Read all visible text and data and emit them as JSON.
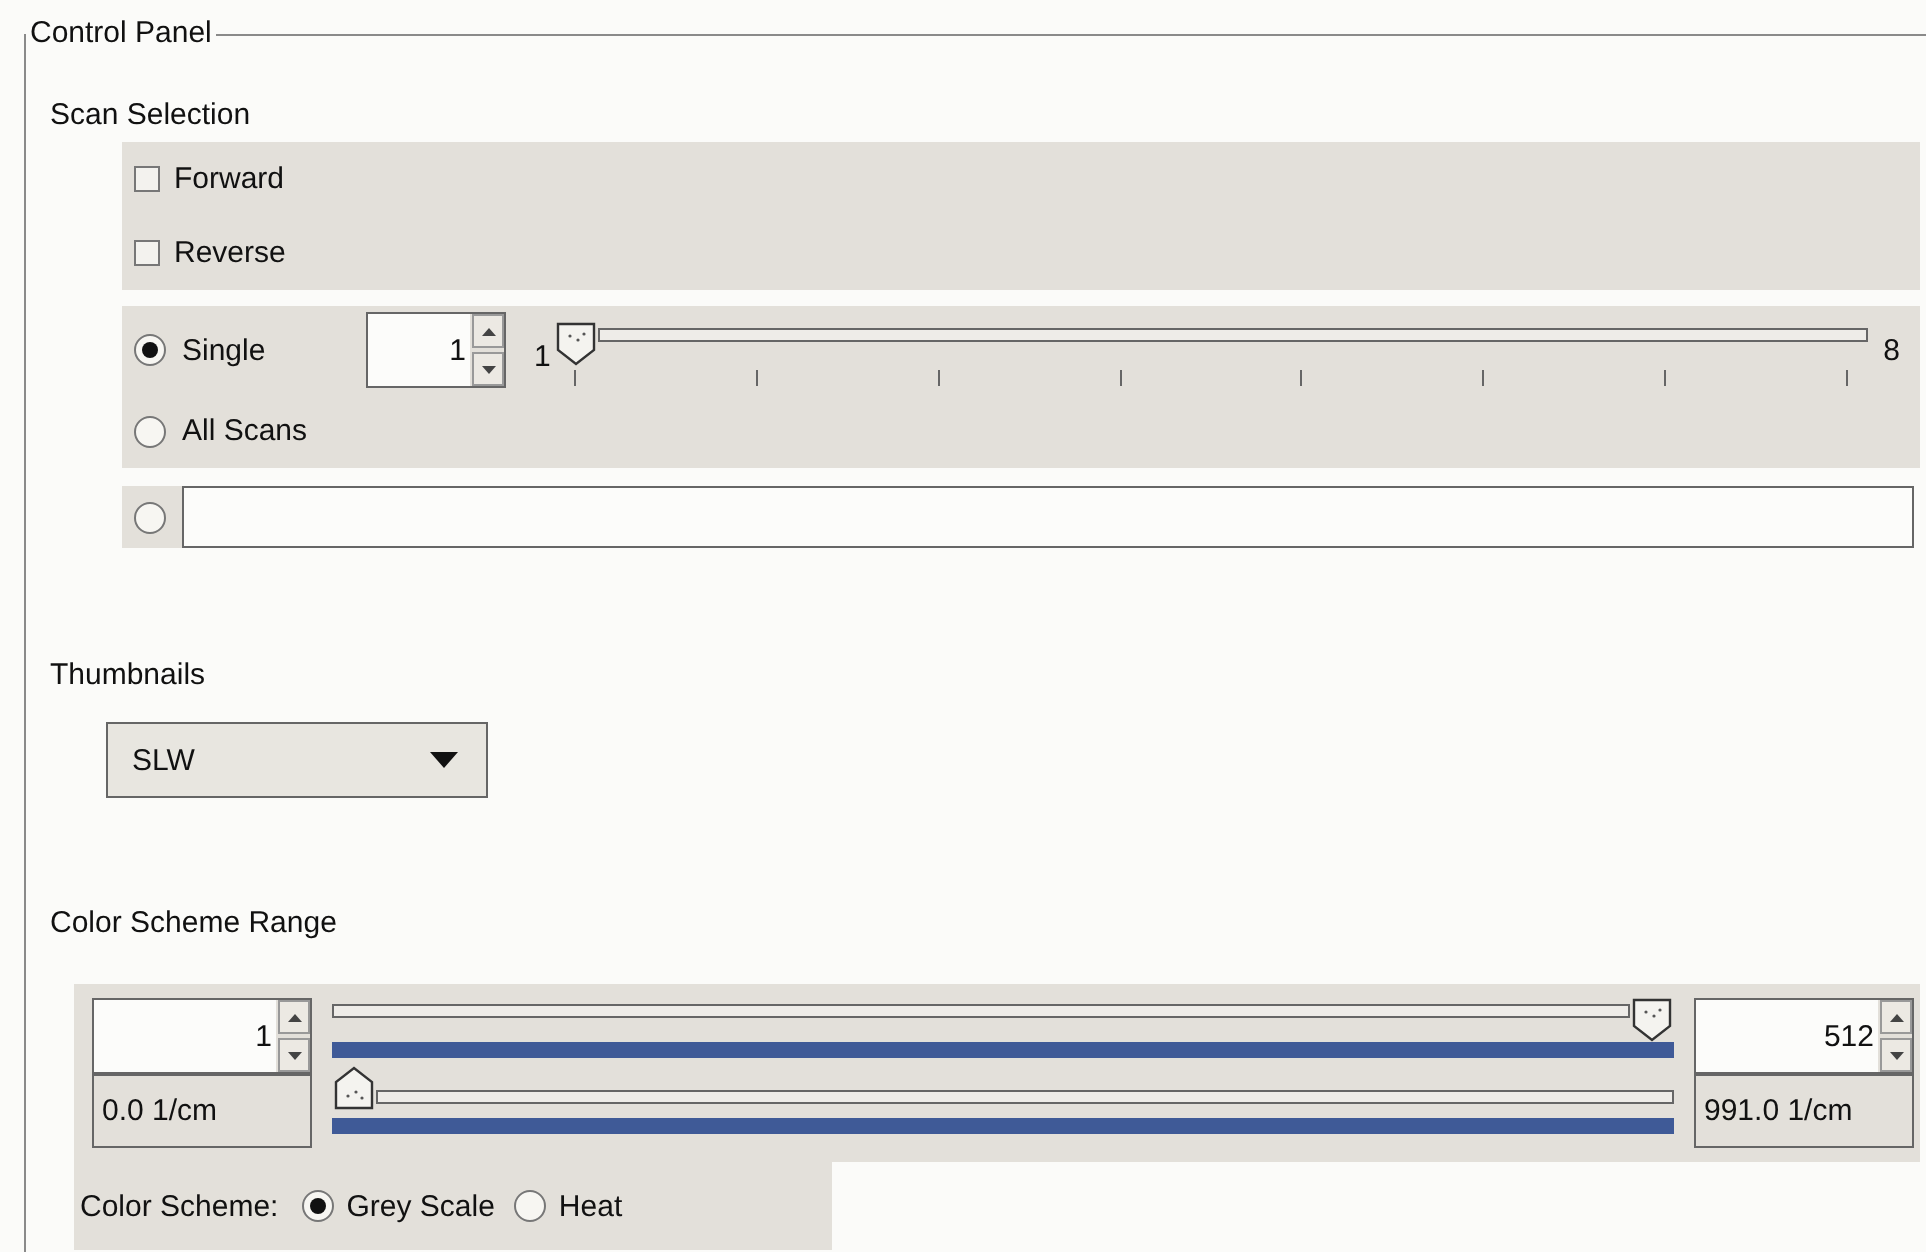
{
  "panel": {
    "title": "Control Panel"
  },
  "scan_selection": {
    "title": "Scan Selection",
    "directions": [
      {
        "label": "Forward",
        "checked": false
      },
      {
        "label": "Reverse",
        "checked": false
      }
    ],
    "modes": [
      {
        "kind": "single",
        "label": "Single",
        "selected": true,
        "spinner_value": "1",
        "slider": {
          "min_label": "1",
          "max_label": "8",
          "level": 0
        }
      },
      {
        "kind": "all",
        "label": "All Scans",
        "selected": false
      },
      {
        "kind": "custom",
        "selected": false
      }
    ]
  },
  "thumbnails": {
    "title": "Thumbnails",
    "value": "SLW"
  },
  "color_scheme_range": {
    "title": "Color Scheme Range",
    "min": {
      "spinner_value": "1",
      "reading": "0.0 1/cm"
    },
    "max": {
      "spinner_value": "512",
      "reading": "991.0 1/cm"
    },
    "sliders": [
      {
        "level": 1
      },
      {
        "level": 0
      }
    ]
  },
  "color_scheme": {
    "label": "Color Scheme:",
    "options": [
      {
        "label": "Grey Scale",
        "selected": true
      },
      {
        "label": "Heat",
        "selected": false
      }
    ]
  }
}
